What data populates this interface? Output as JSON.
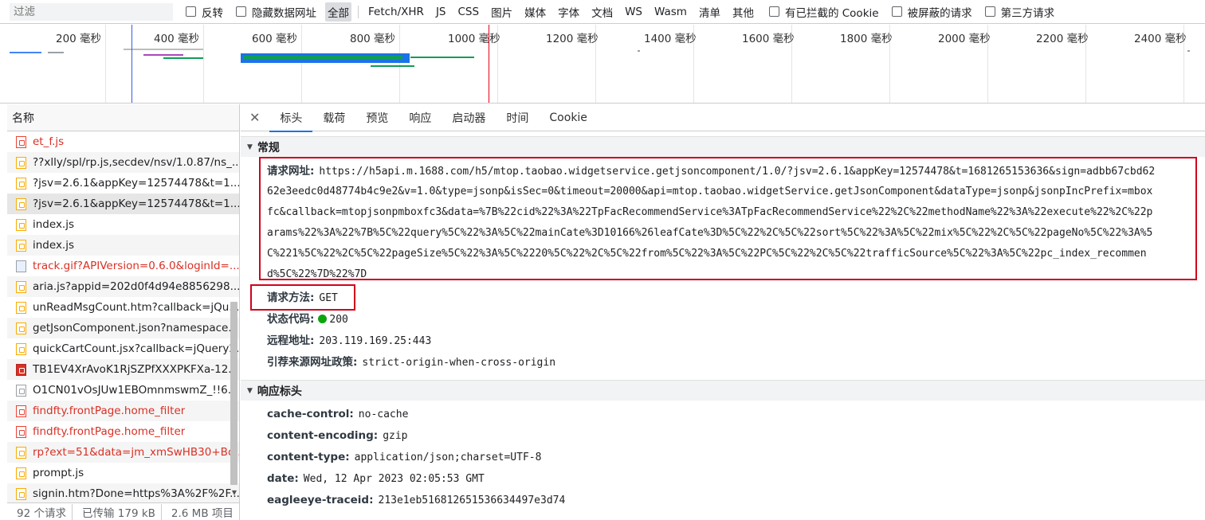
{
  "filter": {
    "placeholder": "过滤",
    "invert_label": "反转",
    "hide_data_urls_label": "隐藏数据网址",
    "types": [
      "全部",
      "Fetch/XHR",
      "JS",
      "CSS",
      "图片",
      "媒体",
      "字体",
      "文档",
      "WS",
      "Wasm",
      "清单",
      "其他"
    ],
    "active_type": "全部",
    "blocked_cookies_label": "有已拦截的 Cookie",
    "blocked_requests_label": "被屏蔽的请求",
    "third_party_label": "第三方请求"
  },
  "overview": {
    "ticks": [
      "200 毫秒",
      "400 毫秒",
      "600 毫秒",
      "800 毫秒",
      "1000 毫秒",
      "1200 毫秒",
      "1400 毫秒",
      "1600 毫秒",
      "1800 毫秒",
      "2000 毫秒",
      "2200 毫秒",
      "2400 毫秒"
    ]
  },
  "list": {
    "header": "名称",
    "rows": [
      {
        "name": "et_f.js",
        "icon": "red",
        "error": true
      },
      {
        "name": "??xlly/spl/rp.js,secdev/nsv/1.0.87/ns_...",
        "icon": "js",
        "error": false
      },
      {
        "name": "?jsv=2.6.1&appKey=12574478&t=1...",
        "icon": "js",
        "error": false
      },
      {
        "name": "?jsv=2.6.1&appKey=12574478&t=1...",
        "icon": "js",
        "error": false,
        "selected": true
      },
      {
        "name": "index.js",
        "icon": "js",
        "error": false
      },
      {
        "name": "index.js",
        "icon": "js",
        "error": false
      },
      {
        "name": "track.gif?APIVersion=0.6.0&loginId=...",
        "icon": "img",
        "error": true
      },
      {
        "name": "aria.js?appid=202d0f4d94e8856298...",
        "icon": "js",
        "error": false
      },
      {
        "name": "unReadMsgCount.htm?callback=jQu...",
        "icon": "js",
        "error": false
      },
      {
        "name": "getJsonComponent.json?namespace...",
        "icon": "js",
        "error": false
      },
      {
        "name": "quickCartCount.jsx?callback=jQuery2...",
        "icon": "js",
        "error": false
      },
      {
        "name": "TB1EV4XrAvoK1RjSZPfXXXPKFXa-12...",
        "icon": "redfill",
        "error": false
      },
      {
        "name": "O1CN01vOsJUw1EBOmnmswmZ_!!6...",
        "icon": "gray",
        "error": false
      },
      {
        "name": "findfty.frontPage.home_filter",
        "icon": "red",
        "error": true
      },
      {
        "name": "findfty.frontPage.home_filter",
        "icon": "red",
        "error": true
      },
      {
        "name": "rp?ext=51&data=jm_xmSwHB30+Bo...",
        "icon": "js",
        "error": true
      },
      {
        "name": "prompt.js",
        "icon": "js",
        "error": false
      },
      {
        "name": "signin.htm?Done=https%3A%2F%2F...",
        "icon": "js",
        "error": false
      }
    ],
    "status": {
      "requests": "92 个请求",
      "transferred": "已传输 179 kB",
      "resources": "2.6 MB 项目"
    }
  },
  "tabs": [
    "标头",
    "载荷",
    "预览",
    "响应",
    "启动器",
    "时间",
    "Cookie"
  ],
  "active_tab": "标头",
  "general": {
    "title": "常规",
    "url_label": "请求网址:",
    "url_lines": [
      "https://h5api.m.1688.com/h5/mtop.taobao.widgetservice.getjsoncomponent/1.0/?jsv=2.6.1&appKey=12574478&t=1681265153636&sign=adbb67cbd62",
      "62e3eedc0d48774b4c9e2&v=1.0&type=jsonp&isSec=0&timeout=20000&api=mtop.taobao.widgetService.getJsonComponent&dataType=jsonp&jsonpIncPrefix=mbox",
      "fc&callback=mtopjsonpmboxfc3&data=%7B%22cid%22%3A%22TpFacRecommendService%3ATpFacRecommendService%22%2C%22methodName%22%3A%22execute%22%2C%22p",
      "arams%22%3A%22%7B%5C%22query%5C%22%3A%5C%22mainCate%3D10166%26leafCate%3D%5C%22%2C%5C%22sort%5C%22%3A%5C%22mix%5C%22%2C%5C%22pageNo%5C%22%3A%5",
      "C%221%5C%22%2C%5C%22pageSize%5C%22%3A%5C%2220%5C%22%2C%5C%22from%5C%22%3A%5C%22PC%5C%22%2C%5C%22trafficSource%5C%22%3A%5C%22pc_index_recommen",
      "d%5C%22%7D%22%7D"
    ],
    "method_label": "请求方法:",
    "method_value": "GET",
    "status_label": "状态代码:",
    "status_value": "200",
    "remote_label": "远程地址:",
    "remote_value": "203.119.169.25:443",
    "referrer_label": "引荐来源网址政策:",
    "referrer_value": "strict-origin-when-cross-origin"
  },
  "response_headers": {
    "title": "响应标头",
    "items": [
      {
        "key": "cache-control:",
        "value": "no-cache"
      },
      {
        "key": "content-encoding:",
        "value": "gzip"
      },
      {
        "key": "content-type:",
        "value": "application/json;charset=UTF-8"
      },
      {
        "key": "date:",
        "value": "Wed, 12 Apr 2023 02:05:53 GMT"
      },
      {
        "key": "eagleeye-traceid:",
        "value": "213e1eb516812651536634497e3d74"
      }
    ]
  },
  "colors": {
    "highlight_box": "#d0021b",
    "status_ok": "#0ca40c",
    "error_text": "#d93025",
    "tab_accent": "#1a73e8"
  }
}
